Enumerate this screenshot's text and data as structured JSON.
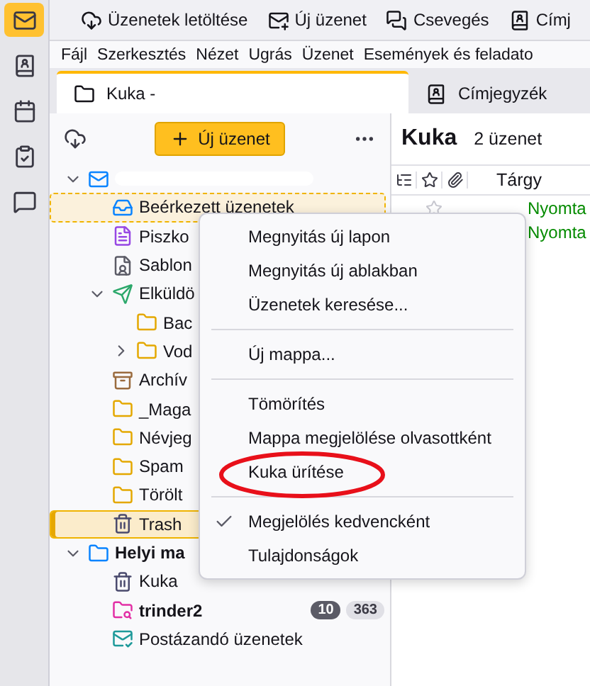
{
  "spaces": [
    {
      "kind": "mail",
      "selected": true
    },
    {
      "kind": "contacts",
      "selected": false
    },
    {
      "kind": "calendar",
      "selected": false
    },
    {
      "kind": "tasks",
      "selected": false
    },
    {
      "kind": "chat",
      "selected": false
    }
  ],
  "toolbar": [
    {
      "kind": "download",
      "label": "Üzenetek letöltése"
    },
    {
      "kind": "compose",
      "label": "Új üzenet"
    },
    {
      "kind": "chat",
      "label": "Csevegés"
    },
    {
      "kind": "contacts",
      "label": "Címj"
    }
  ],
  "menubar": [
    "Fájl",
    "Szerkesztés",
    "Nézet",
    "Ugrás",
    "Üzenet",
    "Események és feladato"
  ],
  "tabs": [
    {
      "kind": "folder",
      "label": "Kuka -",
      "selected": true
    },
    {
      "kind": "contacts",
      "label": "Címjegyzék",
      "selected": false
    }
  ],
  "folder_pane": {
    "new_message": "Új üzenet",
    "tree": [
      {
        "kind": "account",
        "expanded": true,
        "selected": false,
        "focused": false,
        "children": [
          {
            "kind": "inbox",
            "label": "Beérkezett üzenetek",
            "selected": false,
            "focused": true
          },
          {
            "kind": "drafts",
            "label": "Piszko",
            "selected": false,
            "focused": false
          },
          {
            "kind": "templates",
            "label": "Sablon",
            "selected": false,
            "focused": false
          },
          {
            "kind": "sent",
            "label": "Elküldö",
            "expanded": true,
            "selected": false,
            "focused": false,
            "children": [
              {
                "kind": "folder",
                "label": "Bac",
                "selected": false,
                "focused": false
              },
              {
                "kind": "folder",
                "label": "Vod",
                "expanded": false,
                "selected": false,
                "focused": false
              }
            ]
          },
          {
            "kind": "archive",
            "label": "Archív",
            "selected": false,
            "focused": false
          },
          {
            "kind": "folder",
            "label": "_Maga",
            "selected": false,
            "focused": false
          },
          {
            "kind": "folder",
            "label": "Névjeg",
            "selected": false,
            "focused": false
          },
          {
            "kind": "folder",
            "label": "Spam",
            "selected": false,
            "focused": false
          },
          {
            "kind": "folder",
            "label": "Törölt",
            "selected": false,
            "focused": false
          },
          {
            "kind": "trash",
            "label": "Trash",
            "selected": true,
            "focused": false
          }
        ]
      },
      {
        "kind": "local",
        "label": "Helyi ma",
        "bold": true,
        "expanded": true,
        "selected": false,
        "focused": false,
        "children": [
          {
            "kind": "trash",
            "label": "Kuka",
            "selected": false,
            "focused": false
          },
          {
            "kind": "search",
            "label": "trinder2",
            "bold": true,
            "unread": "10",
            "total": "363",
            "selected": false,
            "focused": false
          },
          {
            "kind": "outbox",
            "label": "Postázandó üzenetek",
            "selected": false,
            "focused": false
          }
        ]
      }
    ]
  },
  "message_list": {
    "folder": "Kuka",
    "count": "2 üzenet",
    "subject_header": "Tárgy",
    "rows": [
      {
        "subject": "Nyomta"
      },
      {
        "subject": "Nyomta"
      }
    ]
  },
  "context_menu": [
    {
      "kind": "item",
      "label": "Megnyitás új lapon",
      "checked": false
    },
    {
      "kind": "item",
      "label": "Megnyitás új ablakban",
      "checked": false
    },
    {
      "kind": "item",
      "label": "Üzenetek keresése...",
      "checked": false
    },
    {
      "kind": "separator"
    },
    {
      "kind": "item",
      "label": "Új mappa...",
      "checked": false
    },
    {
      "kind": "separator"
    },
    {
      "kind": "item",
      "label": "Tömörítés",
      "checked": false
    },
    {
      "kind": "item",
      "label": "Mappa megjelölése olvasottként",
      "checked": false
    },
    {
      "kind": "item",
      "label": "Kuka ürítése",
      "checked": false,
      "circled": true
    },
    {
      "kind": "separator"
    },
    {
      "kind": "item",
      "label": "Megjelölés kedvencként",
      "checked": true
    },
    {
      "kind": "item",
      "label": "Tulajdonságok",
      "checked": false
    }
  ]
}
